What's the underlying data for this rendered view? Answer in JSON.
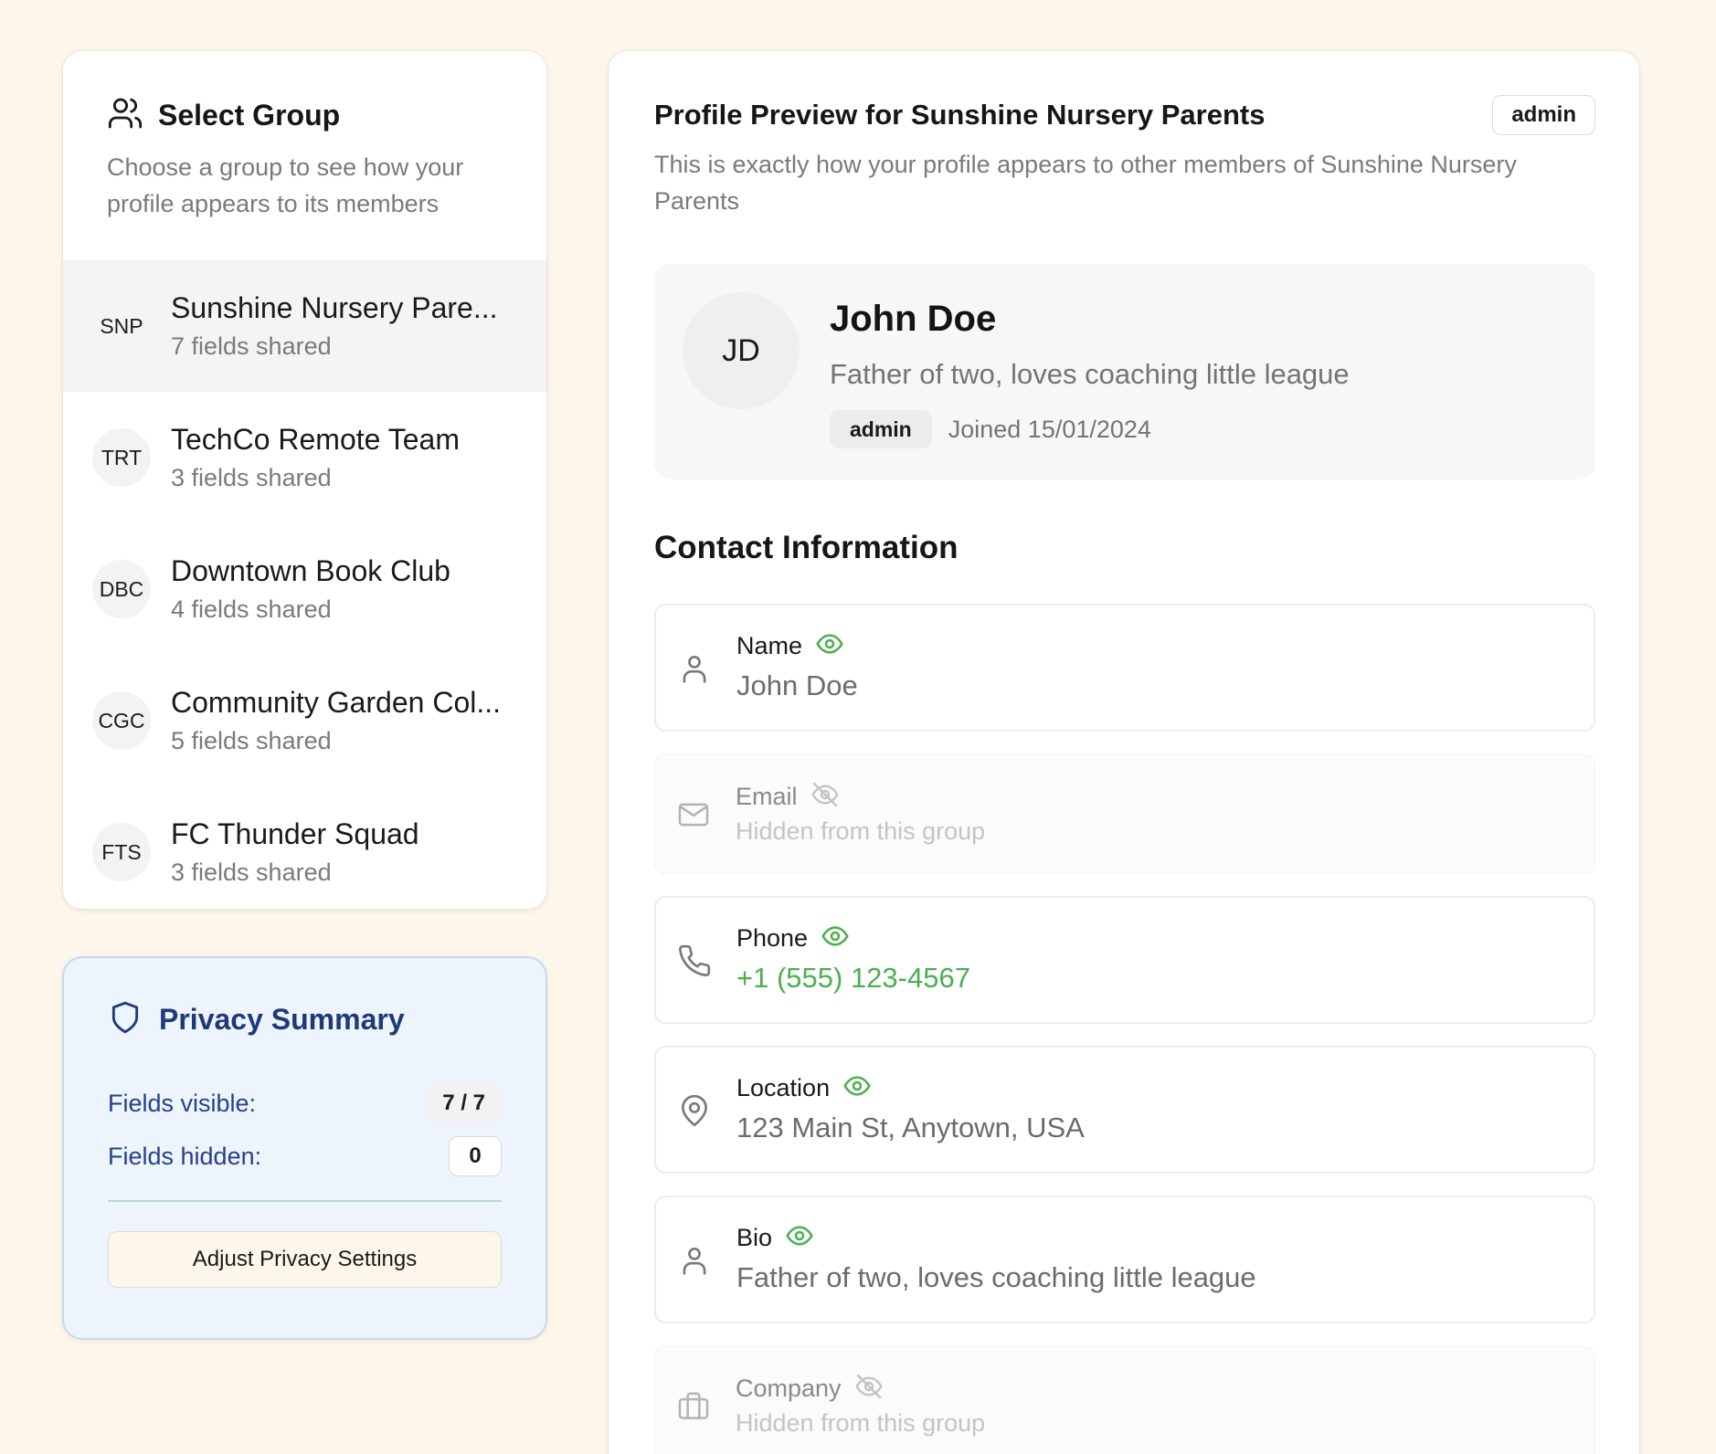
{
  "groups_panel": {
    "title": "Select Group",
    "title_icon": "users-icon",
    "description": "Choose a group to see how your profile appears to its members",
    "items": [
      {
        "initials": "SNP",
        "name": "Sunshine Nursery Pare...",
        "fields": "7 fields shared",
        "selected": true
      },
      {
        "initials": "TRT",
        "name": "TechCo Remote Team",
        "fields": "3 fields shared",
        "selected": false
      },
      {
        "initials": "DBC",
        "name": "Downtown Book Club",
        "fields": "4 fields shared",
        "selected": false
      },
      {
        "initials": "CGC",
        "name": "Community Garden Col...",
        "fields": "5 fields shared",
        "selected": false
      },
      {
        "initials": "FTS",
        "name": "FC Thunder Squad",
        "fields": "3 fields shared",
        "selected": false
      }
    ]
  },
  "privacy": {
    "title": "Privacy Summary",
    "icon": "shield-icon",
    "visible_label": "Fields visible:",
    "visible_value": "7 / 7",
    "hidden_label": "Fields hidden:",
    "hidden_value": "0",
    "button": "Adjust Privacy Settings"
  },
  "preview": {
    "title": "Profile Preview for Sunshine Nursery Parents",
    "role": "admin",
    "description": "This is exactly how your profile appears to other members of Sunshine Nursery Parents",
    "profile": {
      "initials": "JD",
      "name": "John Doe",
      "bio": "Father of two, loves coaching little league",
      "role": "admin",
      "joined": "Joined 15/01/2024"
    },
    "section_title": "Contact Information",
    "fields": {
      "name": {
        "label": "Name",
        "value": "John Doe",
        "icon": "user-icon",
        "visibility": "eye-icon"
      },
      "email": {
        "label": "Email",
        "value": "Hidden from this group",
        "icon": "mail-icon",
        "visibility": "eye-off-icon"
      },
      "phone": {
        "label": "Phone",
        "value": "+1 (555) 123-4567",
        "icon": "phone-icon",
        "visibility": "eye-icon"
      },
      "location": {
        "label": "Location",
        "value": "123 Main St, Anytown, USA",
        "icon": "map-pin-icon",
        "visibility": "eye-icon"
      },
      "bio": {
        "label": "Bio",
        "value": "Father of two, loves coaching little league",
        "icon": "user-icon",
        "visibility": "eye-icon"
      },
      "company": {
        "label": "Company",
        "value": "Hidden from this group",
        "icon": "briefcase-icon",
        "visibility": "eye-off-icon"
      }
    }
  },
  "colors": {
    "background": "#fdf6ea",
    "visible_green": "#4caf50",
    "privacy_blue": "#1f3a78",
    "privacy_bg": "#edf4fc"
  }
}
